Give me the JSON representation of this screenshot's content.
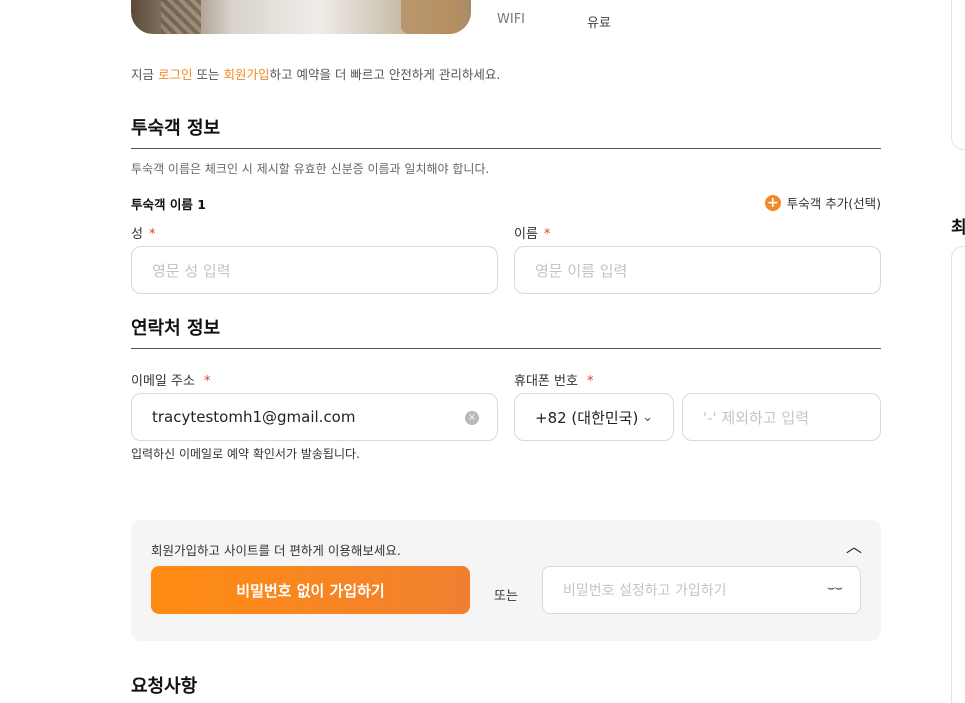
{
  "amenity": {
    "key": "WIFI",
    "value": "유료"
  },
  "login_note": {
    "prefix": "지금 ",
    "login_link": "로그인",
    "mid": " 또는 ",
    "signup_link": "회원가입",
    "suffix": "하고 예약을 더 빠르고 안전하게 관리하세요."
  },
  "guest_section": {
    "title": "투숙객 정보",
    "hint": "투숙객 이름은 체크인 시 제시할 유효한 신분증 이름과 일치해야 합니다.",
    "guest_label": "투숙객 이름 1",
    "add_guest": "투숙객 추가(선택)",
    "last_name_label": "성",
    "last_name_placeholder": "영문 성 입력",
    "first_name_label": "이름",
    "first_name_placeholder": "영문 이름 입력",
    "required_mark": "*"
  },
  "contact_section": {
    "title": "연락처 정보",
    "email_label": "이메일 주소",
    "email_value": "tracytestomh1@gmail.com",
    "phone_label": "휴대폰 번호",
    "country_code": "+82 (대한민국)",
    "phone_placeholder": "'-' 제외하고 입력",
    "email_note": "입력하신 이메일로 예약 확인서가 발송됩니다.",
    "required_mark": "*"
  },
  "signup_box": {
    "text": "회원가입하고 사이트를 더 편하게 이용해보세요.",
    "primary_button": "비밀번호 없이 가입하기",
    "or": "또는",
    "password_placeholder": "비밀번호 설정하고 가입하기"
  },
  "requests_section": {
    "title": "요청사항"
  },
  "right_panel": {
    "heading_char": "최"
  },
  "colors": {
    "accent": "#f08a24",
    "required": "#e8392b"
  }
}
